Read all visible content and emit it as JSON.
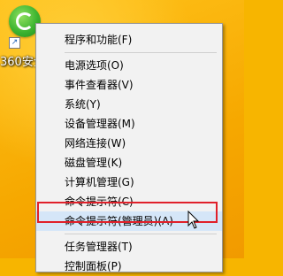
{
  "desktop": {
    "icon_label": "360安全卫士",
    "icon_name": "360-safe-icon",
    "shortcut_arrow": "↗"
  },
  "menu": {
    "items": [
      {
        "label": "程序和功能(F)"
      },
      {
        "label": "电源选项(O)"
      },
      {
        "label": "事件查看器(V)"
      },
      {
        "label": "系统(Y)"
      },
      {
        "label": "设备管理器(M)"
      },
      {
        "label": "网络连接(W)"
      },
      {
        "label": "磁盘管理(K)"
      },
      {
        "label": "计算机管理(G)"
      },
      {
        "label": "命令提示符(C)"
      },
      {
        "label": "命令提示符(管理员)(A)",
        "highlighted": true
      },
      {
        "label": "任务管理器(T)"
      },
      {
        "label": "控制面板(P)"
      }
    ]
  },
  "colors": {
    "highlight_border": "#e0202a",
    "menu_background": "#f2f2f2"
  }
}
